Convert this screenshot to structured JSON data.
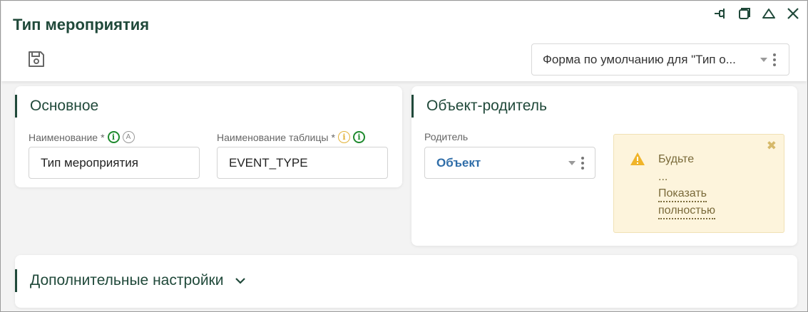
{
  "window": {
    "title": "Тип мероприятия",
    "controls": [
      "pin-icon",
      "restore-icon",
      "collapse-icon",
      "close-icon"
    ]
  },
  "toolbar": {
    "save_icon": "save-icon",
    "form_select_value": "Форма по умолчанию для \"Тип о..."
  },
  "main_section": {
    "title": "Основное",
    "name_field": {
      "label": "Наименование",
      "required_mark": "*",
      "value": "Тип мероприятия"
    },
    "table_field": {
      "label": "Наименование таблицы",
      "required_mark": "*",
      "value": "EVENT_TYPE"
    }
  },
  "parent_section": {
    "title": "Объект-родитель",
    "parent_field": {
      "label": "Родитель",
      "value": "Объект"
    },
    "warning": {
      "text": "Будьте",
      "ellipsis": "...",
      "link_line1": "Показать",
      "link_line2": "полностью"
    }
  },
  "extra_section": {
    "title": "Дополнительные настройки"
  },
  "colors": {
    "accent": "#20493a",
    "info_green": "#1f8a2e",
    "info_yellow": "#e2b23a",
    "link_blue": "#2f6da8",
    "warning_bg": "#fdf4dc"
  }
}
